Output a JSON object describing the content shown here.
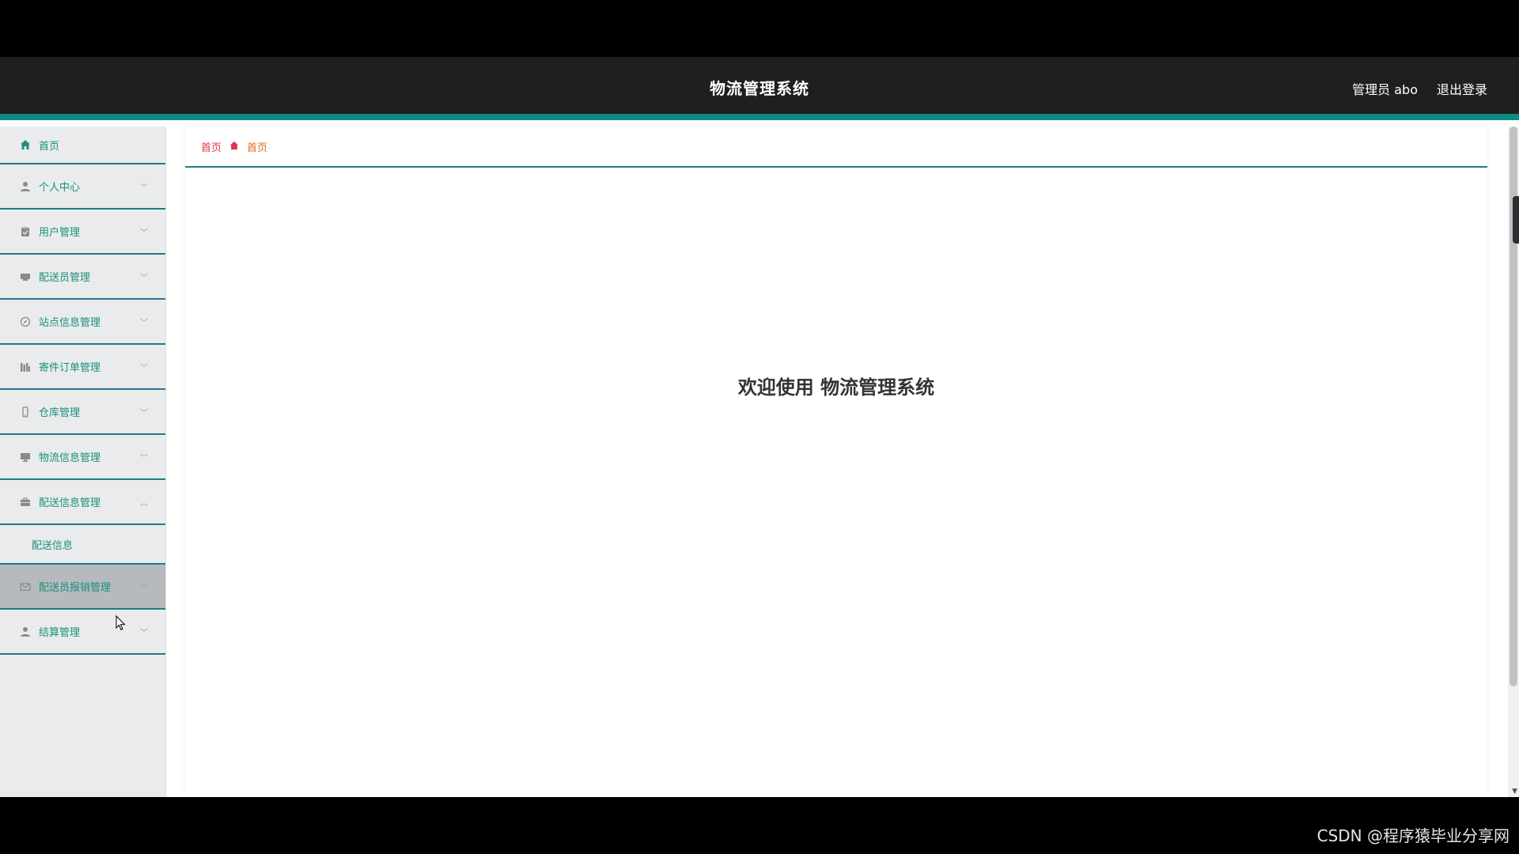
{
  "header": {
    "title": "物流管理系统",
    "user": "管理员 abo",
    "logout": "退出登录"
  },
  "sidebar": {
    "items": [
      {
        "label": "首页",
        "icon": "home-icon",
        "chevron": false
      },
      {
        "label": "个人中心",
        "icon": "user-icon",
        "chevron": true
      },
      {
        "label": "用户管理",
        "icon": "clipboard-icon",
        "chevron": true
      },
      {
        "label": "配送员管理",
        "icon": "courier-icon",
        "chevron": true
      },
      {
        "label": "站点信息管理",
        "icon": "compass-icon",
        "chevron": true
      },
      {
        "label": "寄件订单管理",
        "icon": "bar-chart-icon",
        "chevron": true
      },
      {
        "label": "仓库管理",
        "icon": "mobile-icon",
        "chevron": true
      },
      {
        "label": "物流信息管理",
        "icon": "monitor-icon",
        "chevron": true
      },
      {
        "label": "配送信息管理",
        "icon": "briefcase-icon",
        "chevron": true,
        "expanded": true,
        "children": [
          "配送信息"
        ]
      },
      {
        "label": "配送员报销管理",
        "icon": "envelope-icon",
        "chevron": true,
        "hover": true
      },
      {
        "label": "结算管理",
        "icon": "user-icon",
        "chevron": true
      }
    ]
  },
  "breadcrumb": {
    "root": "首页",
    "current": "首页"
  },
  "main": {
    "welcome": "欢迎使用 物流管理系统"
  },
  "watermark": "CSDN @程序猿毕业分享网",
  "colors": {
    "header_bg": "#1f1f1f",
    "accent": "#0f8a7e",
    "menu_text": "#1a8f7d",
    "breadcrumb_link": "#e2334c",
    "breadcrumb_current": "#e26a1a"
  }
}
